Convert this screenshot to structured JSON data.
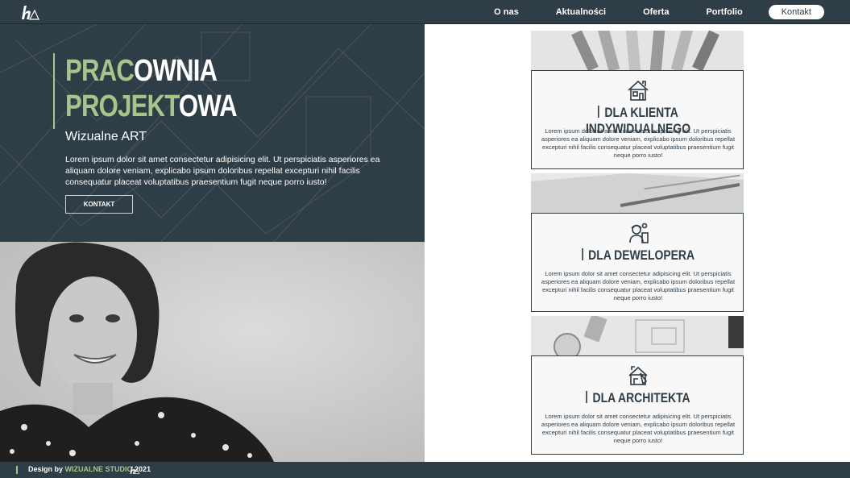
{
  "nav": {
    "items": [
      "O nas",
      "Aktualności",
      "Oferta",
      "Portfolio"
    ],
    "cta": "Kontakt"
  },
  "hero": {
    "title_line1_accent": "PRAC",
    "title_line1_rest": "OWNIA",
    "title_line2_accent": "PROJEKT",
    "title_line2_rest": "OWA",
    "subtitle": "Wizualne ART",
    "text": "Lorem ipsum dolor sit amet consectetur adipisicing elit. Ut perspiciatis asperiores ea aliquam dolore veniam, explicabo ipsum doloribus repellat excepturi nihil facilis consequatur placeat voluptatibus praesentium fugit neque porro iusto!",
    "button": "KONTAKT"
  },
  "cards": [
    {
      "title": "DLA KLIENTA INDYWIDUALNEGO",
      "icon": "house-icon",
      "text": "Lorem ipsum dolor sit amet consectetur adipisicing elit. Ut perspiciatis asperiores ea aliquam dolore veniam, explicabo ipsum doloribus repellat excepturi nihil facilis consequatur placeat voluptatibus praesentium fugit neque porro iusto!"
    },
    {
      "title": "DLA DEWELOPERA",
      "icon": "worker-icon",
      "text": "Lorem ipsum dolor sit amet consectetur adipisicing elit. Ut perspiciatis asperiores ea aliquam dolore veniam, explicabo ipsum doloribus repellat excepturi nihil facilis consequatur placeat voluptatibus praesentium fugit neque porro iusto!"
    },
    {
      "title": "DLA ARCHITEKTA",
      "icon": "blueprint-icon",
      "text": "Lorem ipsum dolor sit amet consectetur adipisicing elit. Ut perspiciatis asperiores ea aliquam dolore veniam, explicabo ipsum doloribus repellat excepturi nihil facilis consequatur placeat voluptatibus praesentium fugit neque porro iusto!"
    }
  ],
  "footer": {
    "prefix": "Design by",
    "studio": "WIZUALNE STUDIO",
    "year": "2021"
  },
  "colors": {
    "primary": "#2f3d47",
    "accent": "#a9c38b",
    "white": "#ffffff"
  }
}
